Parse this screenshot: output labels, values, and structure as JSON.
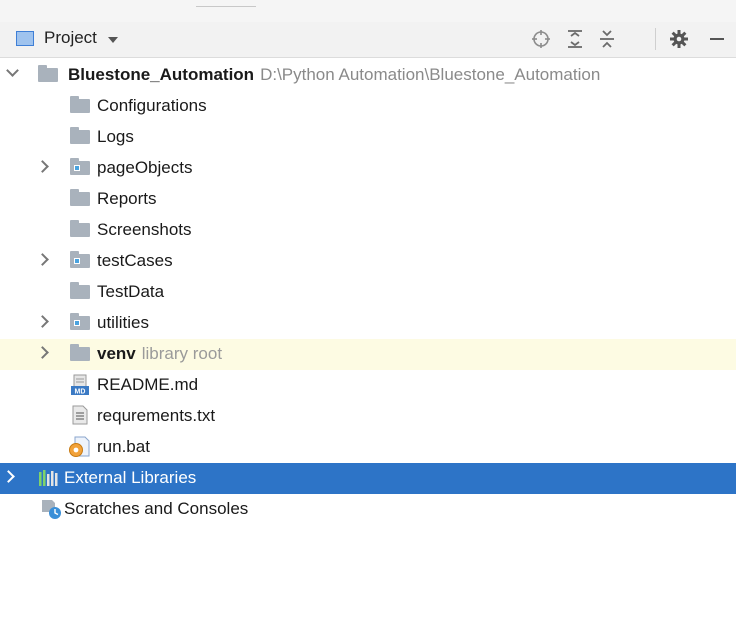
{
  "toolbar": {
    "title": "Project",
    "icons": [
      "locate-icon",
      "expand-all-icon",
      "collapse-all-icon",
      "gear-icon",
      "minimize-icon"
    ]
  },
  "tree": {
    "root": {
      "name": "Bluestone_Automation",
      "path": "D:\\Python Automation\\Bluestone_Automation"
    },
    "items": [
      {
        "label": "Configurations"
      },
      {
        "label": "Logs"
      },
      {
        "label": "pageObjects"
      },
      {
        "label": "Reports"
      },
      {
        "label": "Screenshots"
      },
      {
        "label": "testCases"
      },
      {
        "label": "TestData"
      },
      {
        "label": "utilities"
      },
      {
        "label": "venv",
        "hint": "library root"
      },
      {
        "label": "README.md"
      },
      {
        "label": "requrements.txt"
      },
      {
        "label": "run.bat"
      }
    ],
    "external_libraries": "External Libraries",
    "scratches": "Scratches and Consoles"
  },
  "colors": {
    "selection": "#2d74c7",
    "library_root_highlight": "#fdfbe3",
    "folder": "#a9b2bc",
    "package_badge": "#4aa3df"
  }
}
